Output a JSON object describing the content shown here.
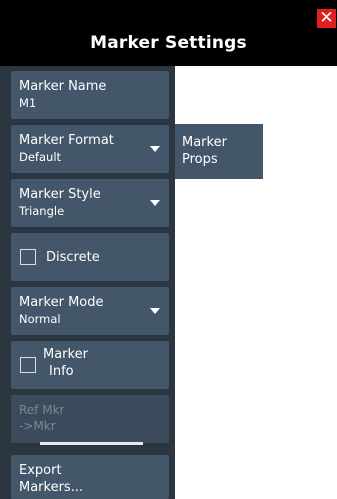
{
  "dialog": {
    "title": "Marker Settings",
    "close_glyph": "✕"
  },
  "buttons": {
    "marker_name": {
      "label": "Marker Name",
      "value": "M1"
    },
    "marker_format": {
      "label": "Marker Format",
      "value": "Default"
    },
    "marker_style": {
      "label": "Marker Style",
      "value": "Triangle"
    },
    "discrete": {
      "label": "Discrete",
      "checked": false
    },
    "marker_mode": {
      "label": "Marker Mode",
      "value": "Normal"
    },
    "marker_info": {
      "line1": "Marker",
      "line2": "Info",
      "checked": false
    },
    "ref_mkr": {
      "line1": "Ref Mkr",
      "line2": "->Mkr",
      "enabled": false
    },
    "export_markers": {
      "line1": "Export",
      "line2": "Markers..."
    }
  },
  "side_tab": {
    "line1": "Marker",
    "line2": "Props"
  },
  "colors": {
    "title_bg": "#000000",
    "panel_bg": "#2b3640",
    "button_bg": "#44566a",
    "close_bg": "#e02020",
    "disabled_text": "#7a8794"
  }
}
